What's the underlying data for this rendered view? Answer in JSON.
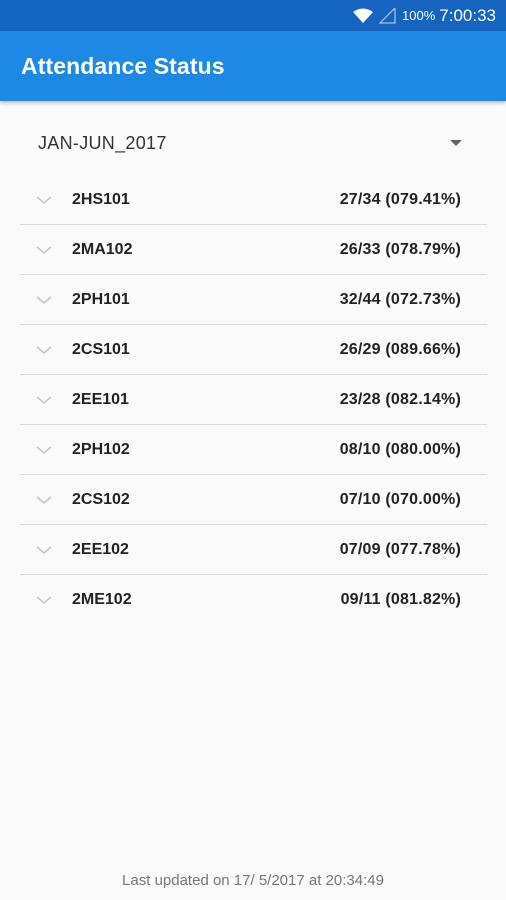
{
  "status_bar": {
    "battery_text": "100%",
    "time": "7:00:33",
    "icons": [
      "wifi-icon",
      "signal-icon"
    ]
  },
  "app_bar": {
    "title": "Attendance Status"
  },
  "spinner": {
    "selected": "JAN-JUN_2017"
  },
  "courses": [
    {
      "code": "2HS101",
      "attendance": "27/34 (079.41%)"
    },
    {
      "code": "2MA102",
      "attendance": "26/33 (078.79%)"
    },
    {
      "code": "2PH101",
      "attendance": "32/44 (072.73%)"
    },
    {
      "code": "2CS101",
      "attendance": "26/29 (089.66%)"
    },
    {
      "code": "2EE101",
      "attendance": "23/28 (082.14%)"
    },
    {
      "code": "2PH102",
      "attendance": "08/10 (080.00%)"
    },
    {
      "code": "2CS102",
      "attendance": "07/10 (070.00%)"
    },
    {
      "code": "2EE102",
      "attendance": "07/09 (077.78%)"
    },
    {
      "code": "2ME102",
      "attendance": "09/11 (081.82%)"
    }
  ],
  "footer": {
    "last_updated": "Last updated on 17/ 5/2017 at 20:34:49"
  },
  "colors": {
    "status_bar": "#1565c0",
    "app_bar": "#1e88e5",
    "background": "#fafafa"
  }
}
